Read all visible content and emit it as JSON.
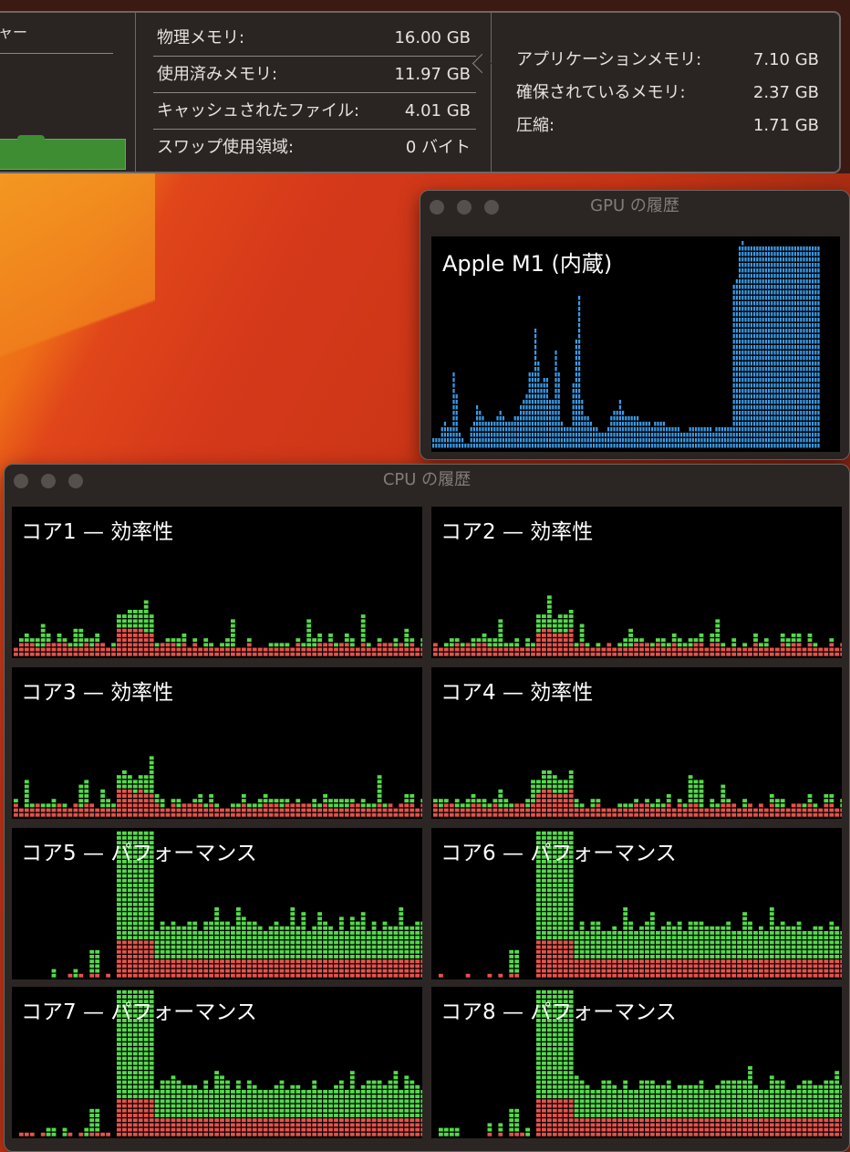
{
  "memory": {
    "truncated_label": "ャー",
    "rows": [
      {
        "label": "物理メモリ:",
        "value": "16.00 GB"
      },
      {
        "label": "使用済みメモリ:",
        "value": "11.97 GB"
      },
      {
        "label": "キャッシュされたファイル:",
        "value": "4.01 GB"
      },
      {
        "label": "スワップ使用領域:",
        "value": "0 バイト"
      }
    ],
    "detail_rows": [
      {
        "label": "アプリケーションメモリ:",
        "value": "7.10 GB"
      },
      {
        "label": "確保されているメモリ:",
        "value": "2.37 GB"
      },
      {
        "label": "圧縮:",
        "value": "1.71 GB"
      }
    ],
    "pressure_color": "#3e8d33"
  },
  "gpu_window": {
    "title": "GPU の履歴",
    "gpu_name": "Apple M1 (内蔵)",
    "bar_color": "#3a9be8",
    "usage_history": [
      2,
      2,
      2,
      4,
      5,
      4,
      4,
      14,
      10,
      3,
      2,
      1,
      1,
      4,
      5,
      8,
      7,
      6,
      5,
      5,
      5,
      5,
      6,
      7,
      6,
      5,
      5,
      5,
      6,
      6,
      8,
      9,
      10,
      14,
      14,
      22,
      16,
      12,
      13,
      13,
      9,
      9,
      18,
      14,
      5,
      4,
      4,
      4,
      12,
      20,
      28,
      9,
      6,
      6,
      5,
      4,
      4,
      3,
      3,
      3,
      4,
      6,
      7,
      7,
      9,
      7,
      6,
      6,
      6,
      6,
      6,
      5,
      5,
      5,
      5,
      4,
      5,
      5,
      5,
      5,
      4,
      4,
      4,
      4,
      4,
      3,
      3,
      3,
      4,
      4,
      4,
      4,
      4,
      4,
      4,
      4,
      3,
      4,
      4,
      4,
      4,
      4,
      4,
      30,
      31,
      37,
      38,
      37,
      37,
      37,
      37,
      37,
      37,
      37,
      37,
      37,
      37,
      37,
      37,
      37,
      37,
      37,
      37,
      37,
      37,
      37,
      37,
      37,
      37,
      37,
      37,
      37,
      37
    ]
  },
  "cpu_window": {
    "title": "CPU の履歴",
    "system_color": "#e5534b",
    "user_color": "#55d94c",
    "cores": [
      {
        "label": "コア1 — 効率性"
      },
      {
        "label": "コア2 — 効率性"
      },
      {
        "label": "コア3 — 効率性"
      },
      {
        "label": "コア4 — 効率性"
      },
      {
        "label": "コア5 — パフォーマンス"
      },
      {
        "label": "コア6 — パフォーマンス"
      },
      {
        "label": "コア7 — パフォーマンス"
      },
      {
        "label": "コア8 — パフォーマンス"
      }
    ]
  }
}
